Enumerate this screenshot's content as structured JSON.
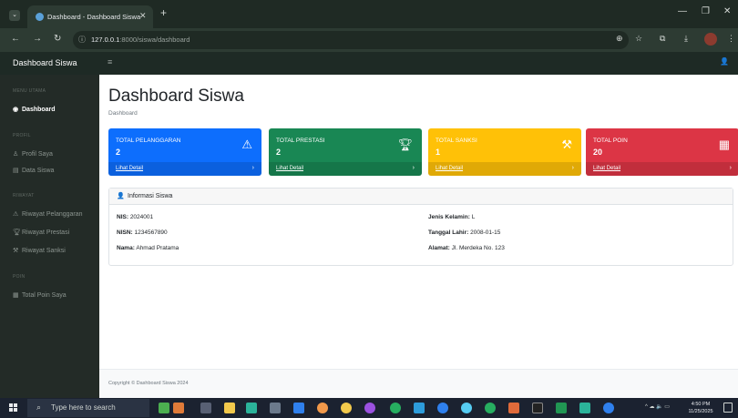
{
  "browser": {
    "tab_title": "Dashboard - Dashboard Siswa",
    "tab_close": "✕",
    "new_tab": "+",
    "url_host": "127.0.0.1",
    "url_rest": ":8000/siswa/dashboard"
  },
  "navbar": {
    "brand": "Dashboard Siswa"
  },
  "sidebar": {
    "sections": [
      {
        "heading": "MENU UTAMA",
        "items": [
          {
            "label": "Dashboard",
            "active": true
          }
        ]
      },
      {
        "heading": "PROFIL",
        "items": [
          {
            "label": "Profil Saya"
          },
          {
            "label": "Data Siswa"
          }
        ]
      },
      {
        "heading": "RIWAYAT",
        "items": [
          {
            "label": "Riwayat Pelanggaran"
          },
          {
            "label": "Riwayat Prestasi"
          },
          {
            "label": "Riwayat Sanksi"
          }
        ]
      },
      {
        "heading": "POIN",
        "items": [
          {
            "label": "Total Poin Saya"
          }
        ]
      }
    ]
  },
  "page": {
    "title": "Dashboard Siswa",
    "breadcrumb": "Dashboard"
  },
  "cards": [
    {
      "label": "TOTAL PELANGGARAN",
      "value": "2",
      "link": "Lihat Detail",
      "color": "#0d6efd",
      "icon": "warning-icon"
    },
    {
      "label": "TOTAL PRESTASI",
      "value": "2",
      "link": "Lihat Detail",
      "color": "#198754",
      "icon": "trophy-icon"
    },
    {
      "label": "TOTAL SANKSI",
      "value": "1",
      "link": "Lihat Detail",
      "color": "#ffc107",
      "icon": "gavel-icon"
    },
    {
      "label": "TOTAL POIN",
      "value": "20",
      "link": "Lihat Detail",
      "color": "#dc3545",
      "icon": "calculator-icon"
    }
  ],
  "info": {
    "title": "Informasi Siswa",
    "fields": {
      "nis": {
        "label": "NIS:",
        "value": "2024001"
      },
      "nisn": {
        "label": "NISN:",
        "value": "1234567890"
      },
      "nama": {
        "label": "Nama:",
        "value": "Ahmad Pratama"
      },
      "jenis_kelamin": {
        "label": "Jenis Kelamin:",
        "value": "L"
      },
      "tanggal_lahir": {
        "label": "Tanggal Lahir:",
        "value": "2008-01-15"
      },
      "alamat": {
        "label": "Alamat:",
        "value": "Jl. Merdeka No. 123"
      }
    }
  },
  "footer": {
    "text": "Copyright © Dashboard Siswa 2024"
  },
  "taskbar": {
    "search_placeholder": "Type here to search",
    "time": "4:50 PM",
    "date": "11/25/2025"
  }
}
